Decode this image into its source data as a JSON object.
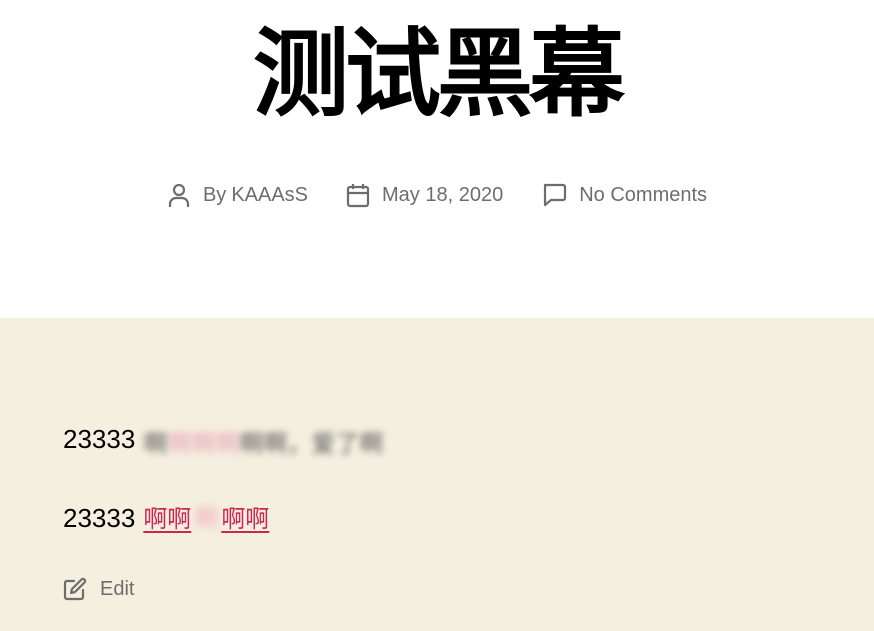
{
  "post": {
    "title": "测试黑幕",
    "meta": {
      "author_prefix": "By",
      "author": "KAAAsS",
      "date": "May 18, 2020",
      "comments": "No Comments"
    }
  },
  "content": {
    "paragraph1": {
      "number": "23333",
      "blurred_text_a": "啊",
      "blurred_text_pink": "啊啊啊",
      "blurred_text_b": "啊啊，爱了啊"
    },
    "paragraph2": {
      "number": "23333",
      "link_text_a": "啊啊",
      "link_text_hidden": "啊",
      "link_text_b": "啊啊"
    },
    "edit_label": "Edit"
  },
  "colors": {
    "accent": "#cd2653",
    "meta_text": "#6d6d6d",
    "content_background": "#f5efe0"
  },
  "icons": {
    "author": "user-icon",
    "date": "calendar-icon",
    "comments": "comment-icon",
    "edit": "edit-icon"
  }
}
